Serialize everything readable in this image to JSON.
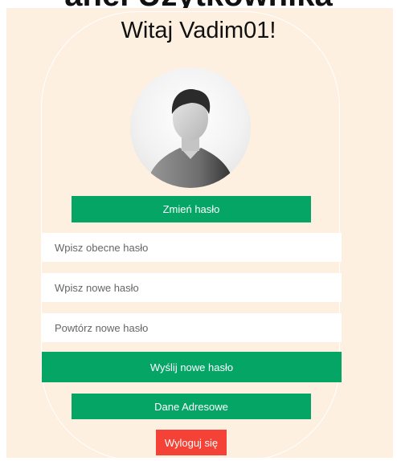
{
  "page": {
    "top_text": "anel Użytkownika",
    "greeting": "Witaj Vadim01!"
  },
  "avatar": {
    "icon": "user-avatar-icon"
  },
  "buttons": {
    "change_password": "Zmień hasło",
    "send_new_password": "Wyślij nowe hasło",
    "address_data": "Dane Adresowe",
    "logout": "Wyloguj się"
  },
  "form": {
    "current_password_placeholder": "Wpisz obecne hasło",
    "new_password_placeholder": "Wpisz nowe hasło",
    "repeat_password_placeholder": "Powtórz nowe hasło"
  },
  "colors": {
    "background": "#fdf0e1",
    "primary_green": "#05a566",
    "logout_red": "#f44336"
  }
}
